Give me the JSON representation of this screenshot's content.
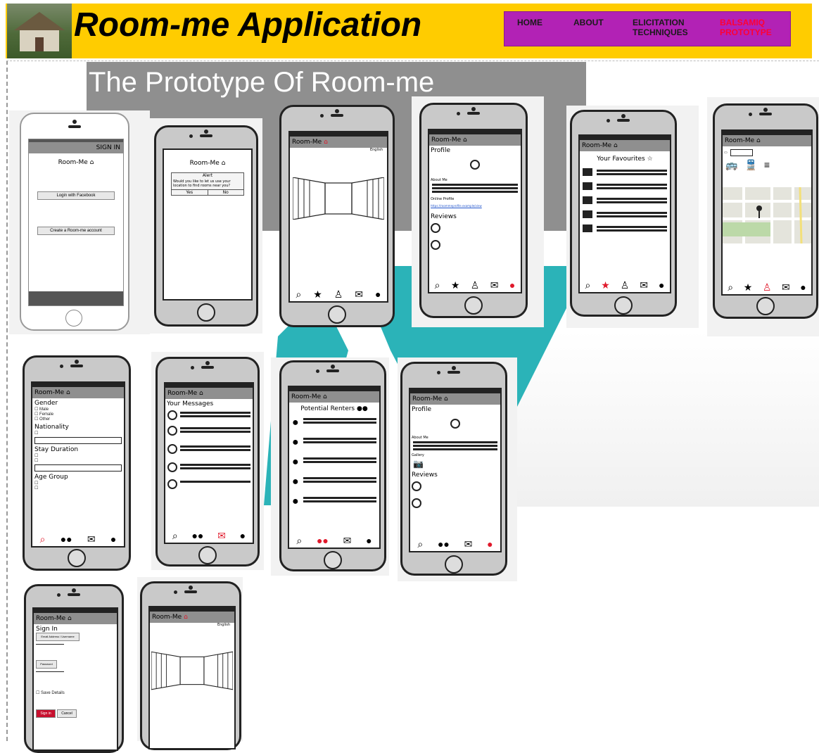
{
  "header": {
    "app_title": "Room-me Application",
    "logo_icon": "house-photo"
  },
  "nav": {
    "items": [
      {
        "label": "HOME",
        "active": false
      },
      {
        "label": "ABOUT",
        "active": false
      },
      {
        "label": "ELICITATION TECHNIQUES",
        "active": false
      },
      {
        "label": "BALSAMIQ PROTOTYPE",
        "active": true
      }
    ],
    "active_color": "#ff0033",
    "bg_color": "#b222b5"
  },
  "colors": {
    "header_bg": "#ffcc00",
    "accent_teal": "#2bb3b8",
    "active_tab": "#e0192b"
  },
  "page": {
    "heading": "The Prototype Of Room-me"
  },
  "mockups": {
    "s1": {
      "title": "Room-Me",
      "sign_in": "SIGN IN",
      "btn1": "Login with Facebook",
      "btn2": "Create a Room-me account"
    },
    "s2": {
      "title": "Room-Me",
      "dialog_title": "Alert",
      "dialog_text": "Would you like to let us use your location to find rooms near you?",
      "yes": "Yes",
      "no": "No"
    },
    "s3": {
      "title": "Room-Me",
      "corner": "English"
    },
    "s4": {
      "title": "Room-Me",
      "heading": "Profile",
      "about": "About Me",
      "link_label": "Online Profile",
      "link": "https://roommeprofile.example/view",
      "reviews": "Reviews"
    },
    "s5": {
      "title": "Room-Me",
      "heading": "Your Favourites"
    },
    "s6": {
      "title": "Room-Me"
    },
    "s7": {
      "title": "Room-Me",
      "gender": "Gender",
      "g1": "Male",
      "g2": "Female",
      "g3": "Other",
      "nationality": "Nationality",
      "stay": "Stay Duration",
      "age": "Age Group"
    },
    "s8": {
      "title": "Room-Me",
      "heading": "Your Messages"
    },
    "s9": {
      "title": "Room-Me",
      "heading": "Potential Renters"
    },
    "s10": {
      "title": "Room-Me",
      "heading": "Profile",
      "about": "About Me",
      "gallery": "Gallery",
      "reviews": "Reviews"
    },
    "s11": {
      "title": "Room-Me",
      "heading": "Sign In",
      "username": "Email Address / Username",
      "password": "Password",
      "save": "Save Details",
      "signin_btn": "Sign in",
      "cancel_btn": "Cancel"
    },
    "s12": {
      "title": "Room-Me",
      "corner": "English"
    }
  }
}
